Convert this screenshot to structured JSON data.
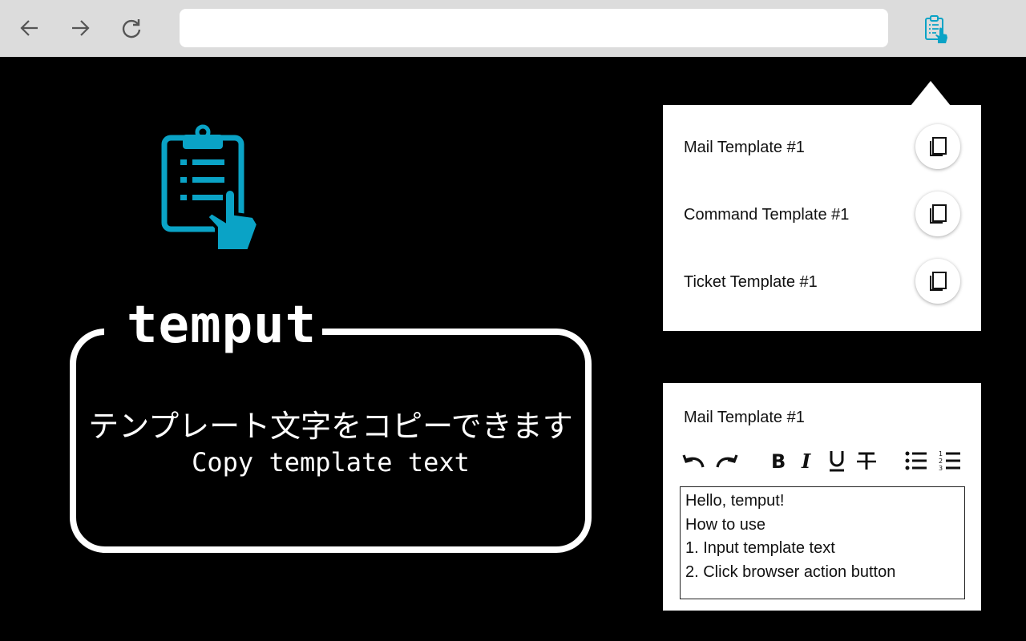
{
  "browser": {
    "address_value": "",
    "nav": {
      "back_icon": "arrow-left-icon",
      "forward_icon": "arrow-right-icon",
      "reload_icon": "reload-icon"
    },
    "extension_icon": "clipboard-hand-icon"
  },
  "colors": {
    "accent": "#0aa3c6",
    "background": "#000000",
    "chrome": "#dcdcdc"
  },
  "hero": {
    "brand": "temput",
    "tagline_jp": "テンプレート文字をコピーできます",
    "tagline_en": "Copy template text"
  },
  "popup": {
    "templates": [
      {
        "label": "Mail Template #1",
        "icon": "copy-icon"
      },
      {
        "label": "Command Template #1",
        "icon": "copy-icon"
      },
      {
        "label": "Ticket Template #1",
        "icon": "copy-icon"
      }
    ]
  },
  "editor": {
    "title": "Mail Template #1",
    "toolbar": [
      "undo-icon",
      "redo-icon",
      "bold-icon",
      "italic-icon",
      "underline-icon",
      "strikethrough-icon",
      "bullet-list-icon",
      "numbered-list-icon"
    ],
    "content_lines": [
      "Hello, temput!",
      "How to use",
      "1. Input template text",
      "2. Click browser action button"
    ]
  }
}
